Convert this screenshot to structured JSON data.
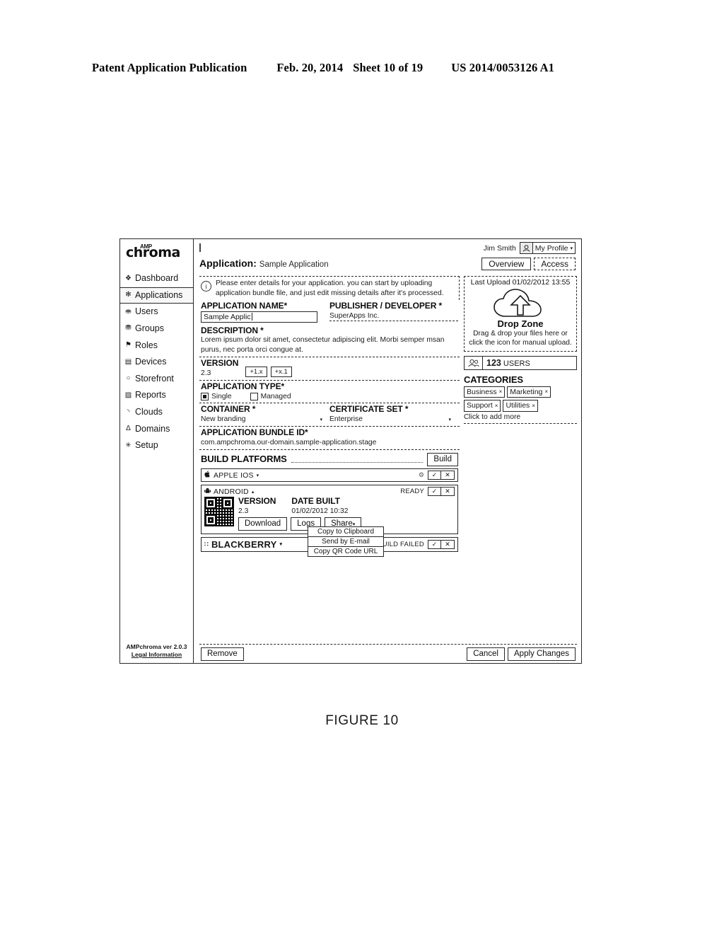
{
  "patent_header": {
    "publication": "Patent Application Publication",
    "date": "Feb. 20, 2014",
    "sheet": "Sheet 10 of 19",
    "number": "US 2014/0053126 A1"
  },
  "figure_caption": "FIGURE 10",
  "sidebar": {
    "logo_word": "chroma",
    "logo_sup": "AMP",
    "items": [
      {
        "label": "Dashboard",
        "icon": "grid-icon",
        "glyph": "❖",
        "active": false
      },
      {
        "label": "Applications",
        "icon": "apps-icon",
        "glyph": "✻",
        "active": true
      },
      {
        "label": "Users",
        "icon": "user-icon",
        "glyph": "⛂",
        "active": false
      },
      {
        "label": "Groups",
        "icon": "group-icon",
        "glyph": "⛃",
        "active": false
      },
      {
        "label": "Roles",
        "icon": "flag-icon",
        "glyph": "⚑",
        "active": false
      },
      {
        "label": "Devices",
        "icon": "device-icon",
        "glyph": "▤",
        "active": false
      },
      {
        "label": "Storefront",
        "icon": "storefront-icon",
        "glyph": "○",
        "active": false
      },
      {
        "label": "Reports",
        "icon": "report-icon",
        "glyph": "▨",
        "active": false
      },
      {
        "label": "Clouds",
        "icon": "cloud-icon",
        "glyph": "◝",
        "active": false
      },
      {
        "label": "Domains",
        "icon": "domain-icon",
        "glyph": "Δ",
        "active": false
      },
      {
        "label": "Setup",
        "icon": "gear-icon",
        "glyph": "✳",
        "active": false
      }
    ],
    "footer_version": "AMPchroma ver 2.0.3",
    "footer_legal": "Legal Information"
  },
  "header": {
    "user_name": "Jim Smith",
    "profile_label": "My Profile",
    "profile_caret": "▾",
    "avatar_icon": "user-avatar-icon",
    "title_label": "Application:",
    "title_value": "Sample Application",
    "tabs": [
      {
        "label": "Overview",
        "selected": true
      },
      {
        "label": "Access",
        "selected": false
      }
    ]
  },
  "info_banner": {
    "icon": "info-icon",
    "text": "Please enter details for your application. you can start by uploading application bundle file, and just edit missing details after it's processed."
  },
  "form": {
    "app_name_label": "APPLICATION NAME*",
    "app_name_value": "Sample Applic",
    "publisher_label": "PUBLISHER / DEVELOPER *",
    "publisher_value": "SuperApps Inc.",
    "description_label": "DESCRIPTION *",
    "description_value": "Lorem ipsum dolor sit amet, consectetur adipiscing elit. Morbi semper msan purus, nec porta orci congue at.",
    "version_label": "VERSION",
    "version_value": "2.3",
    "version_btn_major": "+1.x",
    "version_btn_minor": "+x.1",
    "app_type_label": "APPLICATION TYPE*",
    "app_type_options": [
      {
        "label": "Single",
        "selected": true
      },
      {
        "label": "Managed",
        "selected": false
      }
    ],
    "container_label": "CONTAINER *",
    "container_value": "New branding",
    "certificate_label": "CERTIFICATE SET *",
    "certificate_value": "Enterprise",
    "bundle_label": "APPLICATION BUNDLE ID*",
    "bundle_value": "com.ampchroma.our-domain.sample-application.stage"
  },
  "build": {
    "section_label": "BUILD PLATFORMS",
    "build_button": "Build",
    "platforms": [
      {
        "name": "APPLE IOS",
        "icon": "apple-icon",
        "glyph": "",
        "caret": "▾",
        "status": "",
        "has_gear": true,
        "gear_icon": "gear-icon",
        "check": "✓",
        "close": "✕"
      },
      {
        "name": "ANDROID",
        "icon": "android-icon",
        "glyph": "⚙",
        "caret": "▴",
        "status": "READY",
        "has_gear": false,
        "check": "✓",
        "close": "✕"
      },
      {
        "name": "BLACKBERRY",
        "icon": "blackberry-icon",
        "glyph": "∷",
        "caret": "▾",
        "status": "BUILD FAILED",
        "has_gear": false,
        "check": "✓",
        "close": "✕"
      }
    ],
    "android_detail": {
      "qr_icon": "qr-code-icon",
      "version_label": "VERSION",
      "version_value": "2.3",
      "date_built_label": "DATE BUILT",
      "date_built_value": "01/02/2012 10:32",
      "buttons": [
        "Download",
        "Logs",
        "Share"
      ],
      "share_caret": "▾"
    },
    "share_menu": [
      "Copy to Clipboard",
      "Send by E-mail",
      "Copy QR Code URL"
    ]
  },
  "upload": {
    "last_upload": "Last Upload 01/02/2012 13:55",
    "cloud_icon": "cloud-upload-icon",
    "drop_title": "Drop Zone",
    "drop_hint": "Drag & drop your files here or click the icon for manual upload."
  },
  "users_widget": {
    "icon": "users-icon",
    "count": "123",
    "label": "USERS"
  },
  "categories": {
    "title": "CATEGORIES",
    "tags": [
      "Business",
      "Marketing",
      "Support",
      "Utilities"
    ],
    "remove_glyph": "×",
    "add_more": "Click to add more"
  },
  "footer": {
    "remove": "Remove",
    "cancel": "Cancel",
    "apply": "Apply Changes"
  }
}
